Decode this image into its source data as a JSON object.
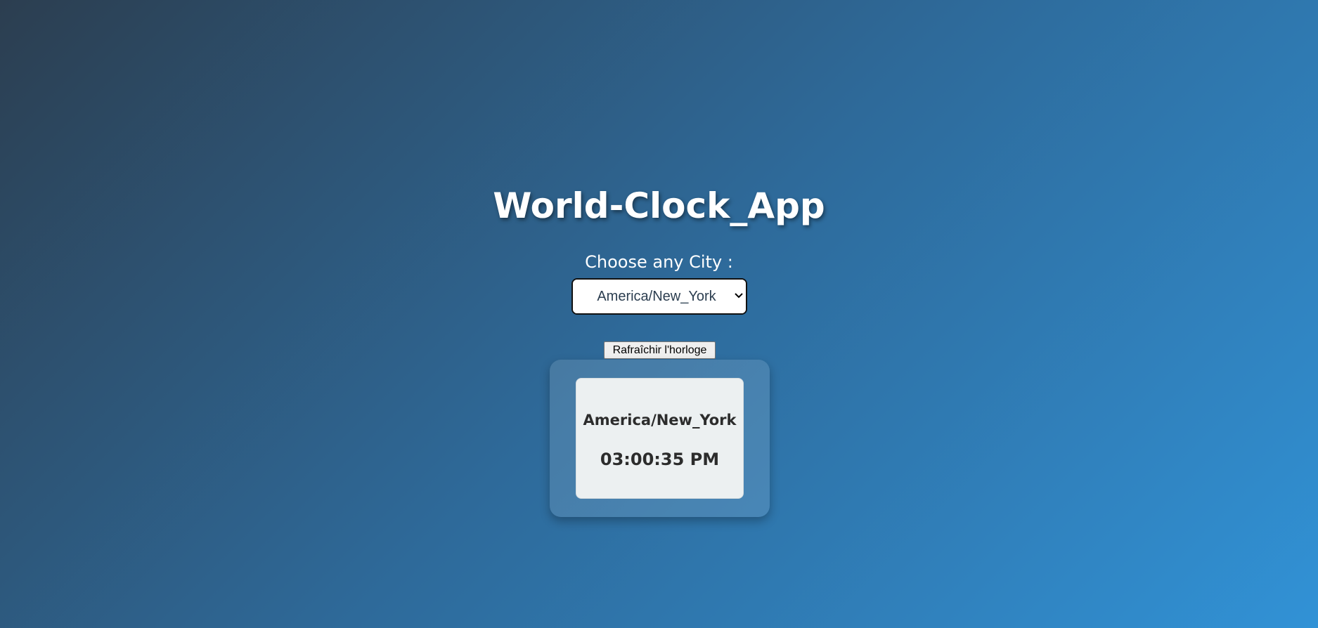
{
  "app": {
    "title": "World-Clock_App"
  },
  "selector": {
    "label": "Choose any City :",
    "selected_value": "America/New_York"
  },
  "refresh_button": {
    "label": "Rafraîchir l'horloge"
  },
  "clocks": [
    {
      "city": "America/New_York",
      "time": "03:00:35 PM"
    }
  ],
  "icons": {
    "select_chevron": "chevron-down-icon"
  },
  "colors": {
    "background_start": "#2c3e50",
    "background_end": "#3192d6",
    "card_background": "#ecf0f1",
    "text_light": "#ffffff",
    "text_dark": "#2c2c2c"
  }
}
